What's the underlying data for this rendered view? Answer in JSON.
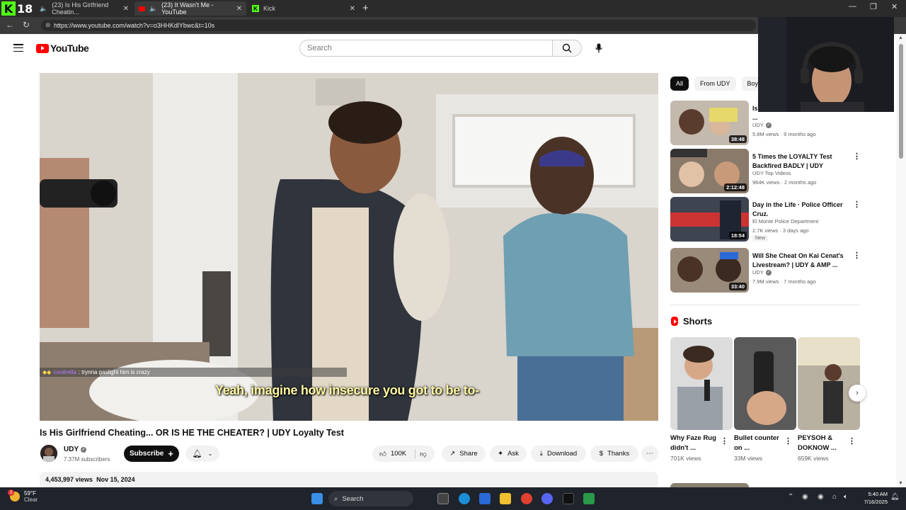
{
  "browser": {
    "stream_badge": "18",
    "tabs": [
      {
        "label": "(23) Is His Girlfriend Cheatin..."
      },
      {
        "label": "(23) It Wasn't Me - YouTube"
      },
      {
        "label": "Kick"
      }
    ],
    "url": "https://www.youtube.com/watch?v=o3HHKdlYbwc&t=10s"
  },
  "youtube": {
    "logo_text": "YouTube",
    "search_placeholder": "Search"
  },
  "player": {
    "chat_user": "coralrella",
    "chat_message": ": trynna gaslight him is crazy",
    "caption": "Yeah, imagine how insecure you got to be to-"
  },
  "video": {
    "title": "Is His Girlfriend Cheating... OR IS HE THE CHEATER? | UDY Loyalty Test",
    "channel": "UDY",
    "subscribers": "7.37M subscribers",
    "subscribe_label": "Subscribe",
    "likes": "100K",
    "share_label": "Share",
    "ask_label": "Ask",
    "download_label": "Download",
    "thanks_label": "Thanks",
    "views": "4,453,997 views",
    "date": "Nov 15, 2024"
  },
  "sidebar": {
    "chips": [
      "All",
      "From UDY",
      "Boyfr"
    ],
    "recommendations": [
      {
        "title": "Is ... Guys At The Club?! | UDY ...",
        "channel": "UDY",
        "meta": "5.8M views · 9 months ago",
        "duration": "38:48",
        "new": ""
      },
      {
        "title": "5 Times the LOYALTY Test Backfired BADLY | UDY",
        "channel": "UDY Top Videos",
        "meta": "964K views · 2 months ago",
        "duration": "2:12:48",
        "new": ""
      },
      {
        "title": "Day in the Life · Police Officer Cruz.",
        "channel": "El Monte Police Department",
        "meta": "2.7K views · 3 days ago",
        "duration": "18:54",
        "new": "New"
      },
      {
        "title": "Will She Cheat On Kai Cenat's Livestream? | UDY & AMP ...",
        "channel": "UDY",
        "meta": "7.9M views · 7 months ago",
        "duration": "33:40",
        "new": ""
      }
    ],
    "shorts_header": "Shorts",
    "shorts": [
      {
        "title": "Why Faze Rug didn't ...",
        "views": "701K views"
      },
      {
        "title": "Bullet counter on ...",
        "views": "33M views"
      },
      {
        "title": "PEYSOH & DOKNOW ...",
        "views": "659K views"
      }
    ]
  },
  "taskbar": {
    "weather_temp": "59°F",
    "weather_cond": "Clear",
    "weather_badge": "3",
    "search_label": "Search",
    "time": "5:40 AM",
    "date": "7/16/2025"
  }
}
